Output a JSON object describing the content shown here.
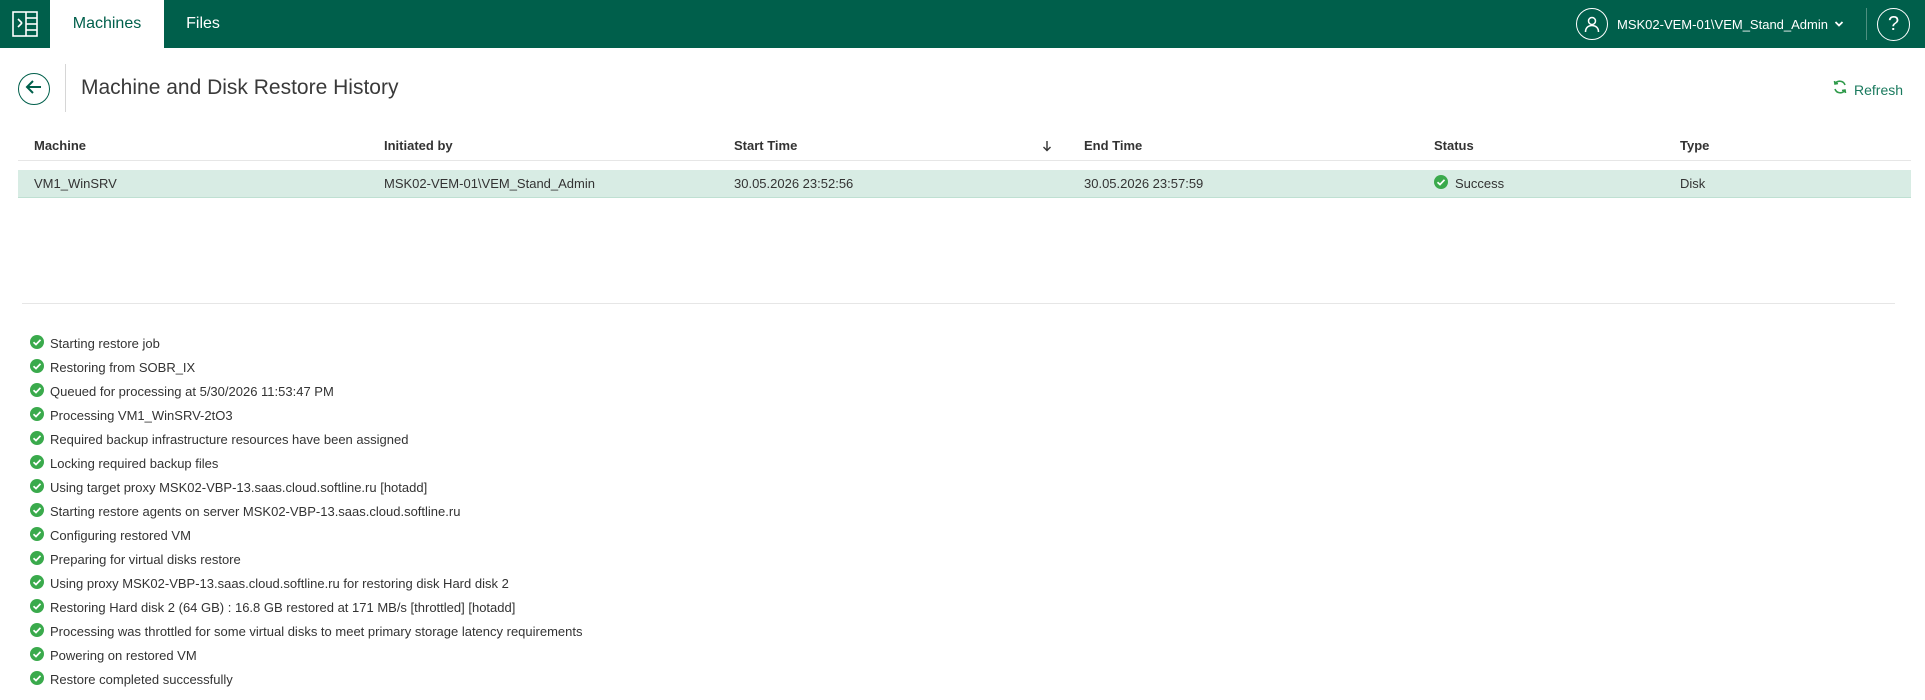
{
  "nav": {
    "tabs": [
      {
        "label": "Machines",
        "active": true
      },
      {
        "label": "Files",
        "active": false
      }
    ],
    "user": "MSK02-VEM-01\\VEM_Stand_Admin",
    "help": "?"
  },
  "page": {
    "title": "Machine and Disk Restore History",
    "refresh_label": "Refresh"
  },
  "grid": {
    "columns": [
      "Machine",
      "Initiated by",
      "Start Time",
      "End Time",
      "Status",
      "Type"
    ],
    "sorted_column": "Start Time",
    "sort_direction": "descending",
    "rows": [
      {
        "machine": "VM1_WinSRV",
        "initiated_by": "MSK02-VEM-01\\VEM_Stand_Admin",
        "start_time": "30.05.2026 23:52:56",
        "end_time": "30.05.2026 23:57:59",
        "status": "Success",
        "type": "Disk"
      }
    ]
  },
  "log": [
    "Starting restore job",
    "Restoring from SOBR_IX",
    "Queued for processing at 5/30/2026 11:53:47 PM",
    "Processing VM1_WinSRV-2tO3",
    "Required backup infrastructure resources have been assigned",
    "Locking required backup files",
    "Using target proxy MSK02-VBP-13.saas.cloud.softline.ru [hotadd]",
    "Starting restore agents on server MSK02-VBP-13.saas.cloud.softline.ru",
    "Configuring restored VM",
    "Preparing for virtual disks restore",
    "Using proxy MSK02-VBP-13.saas.cloud.softline.ru for restoring disk Hard disk 2",
    "Restoring Hard disk 2 (64 GB) : 16.8 GB restored at 171 MB/s [throttled] [hotadd]",
    "Processing was throttled for some virtual disks to meet primary storage latency requirements",
    "Powering on restored VM",
    "Restore completed successfully"
  ],
  "colors": {
    "brand": "#005f4b",
    "selected_row": "#d8ece4",
    "success": "#3aaa4c",
    "link": "#1a7a5e"
  },
  "icons": {
    "logo": "app-logo-icon",
    "user": "user-icon",
    "menu": "chevron-down-icon",
    "help": "help-icon",
    "back": "arrow-left-icon",
    "refresh": "refresh-icon",
    "sort": "arrow-down-icon",
    "status": "check-circle-icon"
  }
}
